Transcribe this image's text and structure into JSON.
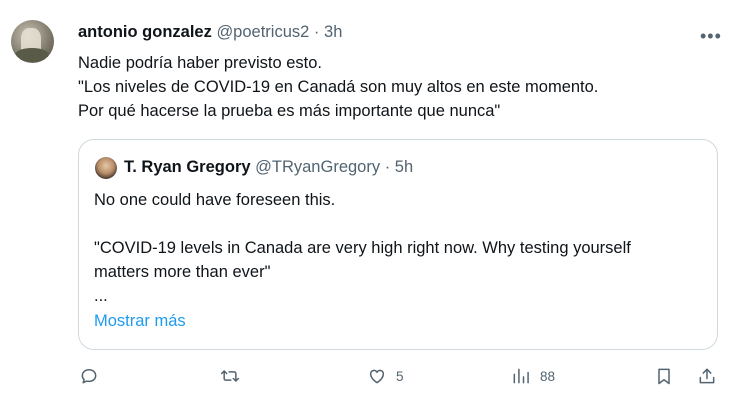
{
  "tweet": {
    "author_name": "antonio gonzalez",
    "author_handle": "@poetricus2",
    "separator": "·",
    "time": "3h",
    "more_label": "•••",
    "text_lines": [
      "Nadie podría haber previsto esto.",
      "\"Los niveles de COVID-19 en Canadá son muy altos en este momento.",
      "Por qué hacerse la prueba es más importante que nunca\""
    ]
  },
  "quote": {
    "author_name": "T. Ryan Gregory",
    "author_handle": "@TRyanGregory",
    "separator": "·",
    "time": "5h",
    "text_lines": [
      "No one could have foreseen this.",
      "",
      "\"COVID-19 levels in Canada are very high right now. Why testing yourself",
      "matters more than ever\"",
      "..."
    ],
    "show_more": "Mostrar más"
  },
  "actions": {
    "reply_icon": "reply-icon",
    "retweet_icon": "retweet-icon",
    "like_icon": "heart-icon",
    "like_count": "5",
    "views_icon": "views-icon",
    "views_count": "88",
    "bookmark_icon": "bookmark-icon",
    "share_icon": "share-icon"
  },
  "colors": {
    "text": "#0f1419",
    "secondary": "#536471",
    "link": "#1d9bf0",
    "border": "#cfd9de"
  }
}
